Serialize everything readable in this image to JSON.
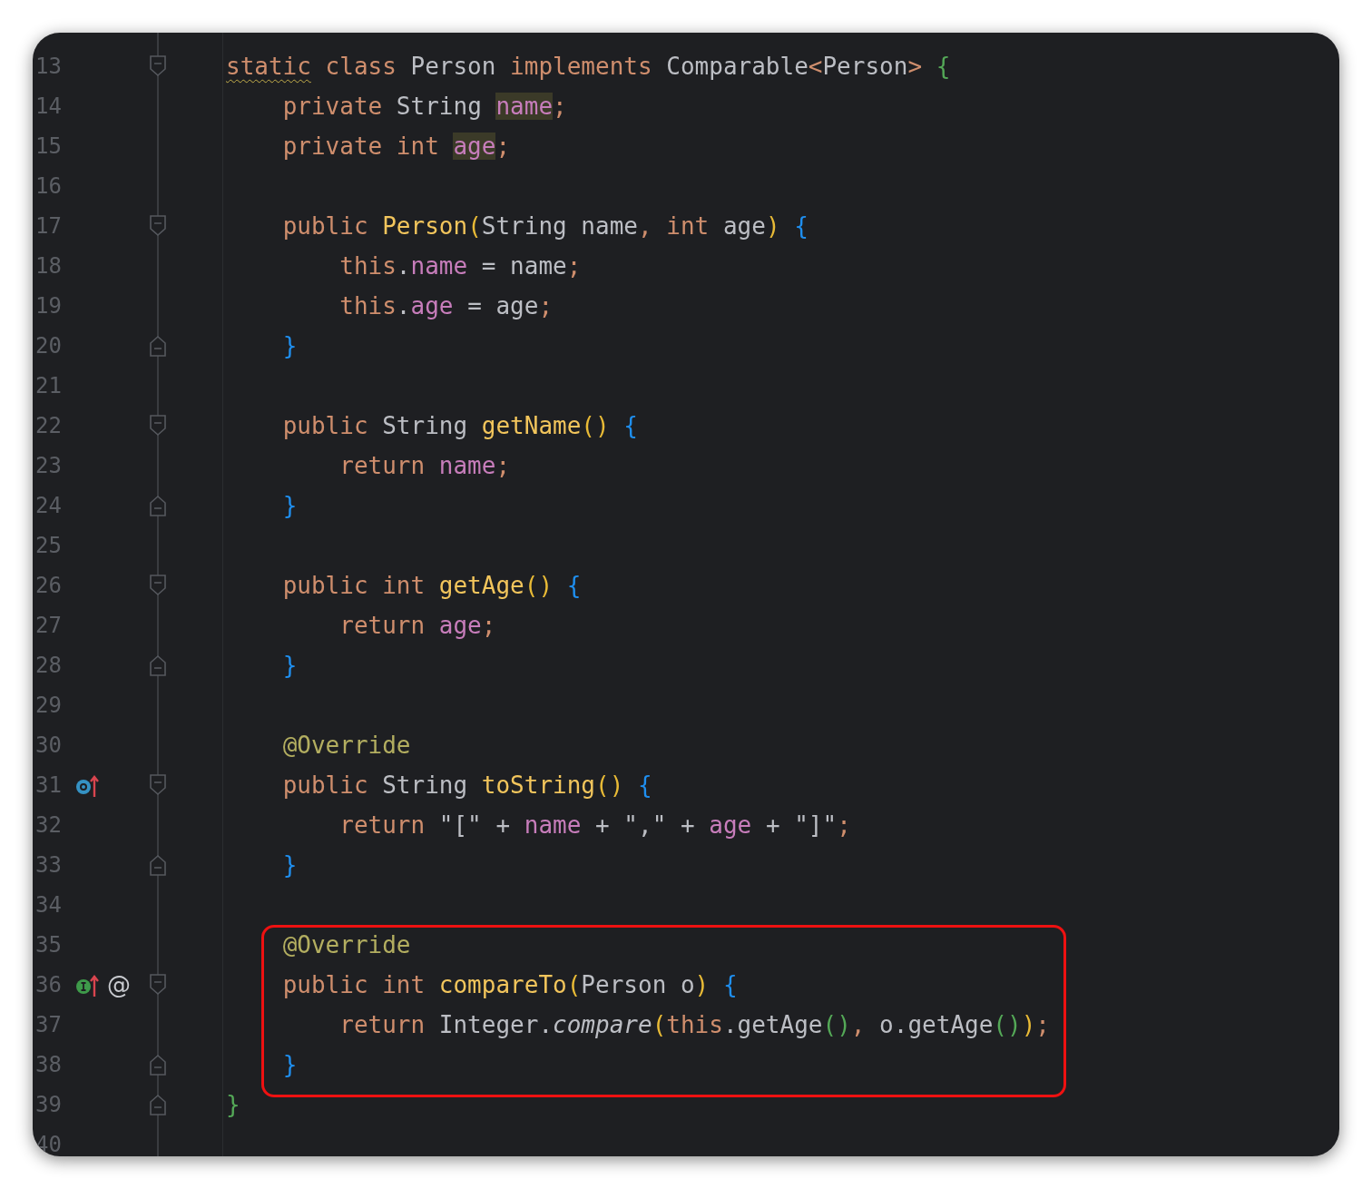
{
  "editor": {
    "lines": [
      {
        "number": "13",
        "fold_start": true,
        "tokens": [
          {
            "text": "static",
            "kind": "kw",
            "warn": true
          },
          {
            "text": " class ",
            "kind": "kw"
          },
          {
            "text": "Person ",
            "kind": "plain"
          },
          {
            "text": "implements ",
            "kind": "kw"
          },
          {
            "text": "Comparable",
            "kind": "plain"
          },
          {
            "text": "<",
            "kind": "kw"
          },
          {
            "text": "Person",
            "kind": "plain"
          },
          {
            "text": ">",
            "kind": "kw"
          },
          {
            "text": " {",
            "kind": "brace-green"
          }
        ]
      },
      {
        "number": "14",
        "tokens": [
          {
            "text": "    private ",
            "kind": "kw"
          },
          {
            "text": "String ",
            "kind": "plain"
          },
          {
            "text": "name",
            "kind": "field",
            "hl": true
          },
          {
            "text": ";",
            "kind": "kw"
          }
        ]
      },
      {
        "number": "15",
        "tokens": [
          {
            "text": "    private int ",
            "kind": "kw"
          },
          {
            "text": "age",
            "kind": "field",
            "hl": true
          },
          {
            "text": ";",
            "kind": "kw"
          }
        ]
      },
      {
        "number": "16"
      },
      {
        "number": "17",
        "fold_start": true,
        "tokens": [
          {
            "text": "    public ",
            "kind": "kw"
          },
          {
            "text": "Person",
            "kind": "decl"
          },
          {
            "text": "(",
            "kind": "paren"
          },
          {
            "text": "String name",
            "kind": "plain"
          },
          {
            "text": ", ",
            "kind": "kw"
          },
          {
            "text": "int ",
            "kind": "kw"
          },
          {
            "text": "age",
            "kind": "plain"
          },
          {
            "text": ")",
            "kind": "paren"
          },
          {
            "text": " {",
            "kind": "brace-blue"
          }
        ]
      },
      {
        "number": "18",
        "tokens": [
          {
            "text": "        this",
            "kind": "kw"
          },
          {
            "text": ".",
            "kind": "plain"
          },
          {
            "text": "name",
            "kind": "field"
          },
          {
            "text": " = name",
            "kind": "plain"
          },
          {
            "text": ";",
            "kind": "kw"
          }
        ]
      },
      {
        "number": "19",
        "tokens": [
          {
            "text": "        this",
            "kind": "kw"
          },
          {
            "text": ".",
            "kind": "plain"
          },
          {
            "text": "age",
            "kind": "field"
          },
          {
            "text": " = age",
            "kind": "plain"
          },
          {
            "text": ";",
            "kind": "kw"
          }
        ]
      },
      {
        "number": "20",
        "fold_end": true,
        "tokens": [
          {
            "text": "    }",
            "kind": "brace-blue"
          }
        ]
      },
      {
        "number": "21"
      },
      {
        "number": "22",
        "fold_start": true,
        "tokens": [
          {
            "text": "    public ",
            "kind": "kw"
          },
          {
            "text": "String ",
            "kind": "plain"
          },
          {
            "text": "getName",
            "kind": "decl"
          },
          {
            "text": "()",
            "kind": "paren"
          },
          {
            "text": " {",
            "kind": "brace-blue"
          }
        ]
      },
      {
        "number": "23",
        "tokens": [
          {
            "text": "        return ",
            "kind": "kw"
          },
          {
            "text": "name",
            "kind": "field"
          },
          {
            "text": ";",
            "kind": "kw"
          }
        ]
      },
      {
        "number": "24",
        "fold_end": true,
        "tokens": [
          {
            "text": "    }",
            "kind": "brace-blue"
          }
        ]
      },
      {
        "number": "25"
      },
      {
        "number": "26",
        "fold_start": true,
        "tokens": [
          {
            "text": "    public int ",
            "kind": "kw"
          },
          {
            "text": "getAge",
            "kind": "decl"
          },
          {
            "text": "()",
            "kind": "paren"
          },
          {
            "text": " {",
            "kind": "brace-blue"
          }
        ]
      },
      {
        "number": "27",
        "tokens": [
          {
            "text": "        return ",
            "kind": "kw"
          },
          {
            "text": "age",
            "kind": "field"
          },
          {
            "text": ";",
            "kind": "kw"
          }
        ]
      },
      {
        "number": "28",
        "fold_end": true,
        "tokens": [
          {
            "text": "    }",
            "kind": "brace-blue"
          }
        ]
      },
      {
        "number": "29"
      },
      {
        "number": "30",
        "tokens": [
          {
            "text": "    @Override",
            "kind": "annotation"
          }
        ]
      },
      {
        "number": "31",
        "fold_start": true,
        "gutter_icons": [
          {
            "kind": "overrides"
          }
        ],
        "tokens": [
          {
            "text": "    public ",
            "kind": "kw"
          },
          {
            "text": "String ",
            "kind": "plain"
          },
          {
            "text": "toString",
            "kind": "decl"
          },
          {
            "text": "()",
            "kind": "paren"
          },
          {
            "text": " {",
            "kind": "brace-blue"
          }
        ]
      },
      {
        "number": "32",
        "tokens": [
          {
            "text": "        return ",
            "kind": "kw"
          },
          {
            "text": "\"[\"",
            "kind": "string"
          },
          {
            "text": " + ",
            "kind": "plain"
          },
          {
            "text": "name",
            "kind": "field"
          },
          {
            "text": " + ",
            "kind": "plain"
          },
          {
            "text": "\",\"",
            "kind": "string"
          },
          {
            "text": " + ",
            "kind": "plain"
          },
          {
            "text": "age",
            "kind": "field"
          },
          {
            "text": " + ",
            "kind": "plain"
          },
          {
            "text": "\"]\"",
            "kind": "string"
          },
          {
            "text": ";",
            "kind": "kw"
          }
        ]
      },
      {
        "number": "33",
        "fold_end": true,
        "tokens": [
          {
            "text": "    }",
            "kind": "brace-blue"
          }
        ]
      },
      {
        "number": "34"
      },
      {
        "number": "35",
        "boxed": true,
        "tokens": [
          {
            "text": "    @Override",
            "kind": "annotation"
          }
        ]
      },
      {
        "number": "36",
        "fold_start": true,
        "boxed": true,
        "gutter_icons": [
          {
            "kind": "implements"
          }
        ],
        "gutter_text": "@",
        "tokens": [
          {
            "text": "    public int ",
            "kind": "kw"
          },
          {
            "text": "compareTo",
            "kind": "decl"
          },
          {
            "text": "(",
            "kind": "paren"
          },
          {
            "text": "Person o",
            "kind": "plain"
          },
          {
            "text": ")",
            "kind": "paren"
          },
          {
            "text": " {",
            "kind": "brace-blue"
          }
        ]
      },
      {
        "number": "37",
        "boxed": true,
        "tokens": [
          {
            "text": "        return ",
            "kind": "kw"
          },
          {
            "text": "Integer.",
            "kind": "plain"
          },
          {
            "text": "compare",
            "kind": "static-call"
          },
          {
            "text": "(",
            "kind": "paren"
          },
          {
            "text": "this",
            "kind": "kw"
          },
          {
            "text": ".getAge",
            "kind": "plain"
          },
          {
            "text": "()",
            "kind": "paren-green"
          },
          {
            "text": ", ",
            "kind": "kw"
          },
          {
            "text": "o.getAge",
            "kind": "plain"
          },
          {
            "text": "()",
            "kind": "paren-green"
          },
          {
            "text": ")",
            "kind": "paren"
          },
          {
            "text": ";",
            "kind": "kw"
          }
        ]
      },
      {
        "number": "38",
        "fold_end": true,
        "boxed": true,
        "tokens": [
          {
            "text": "    }",
            "kind": "brace-blue"
          }
        ]
      },
      {
        "number": "39",
        "fold_end": true,
        "tokens": [
          {
            "text": "}",
            "kind": "brace-green"
          }
        ]
      },
      {
        "number": "40"
      }
    ]
  }
}
